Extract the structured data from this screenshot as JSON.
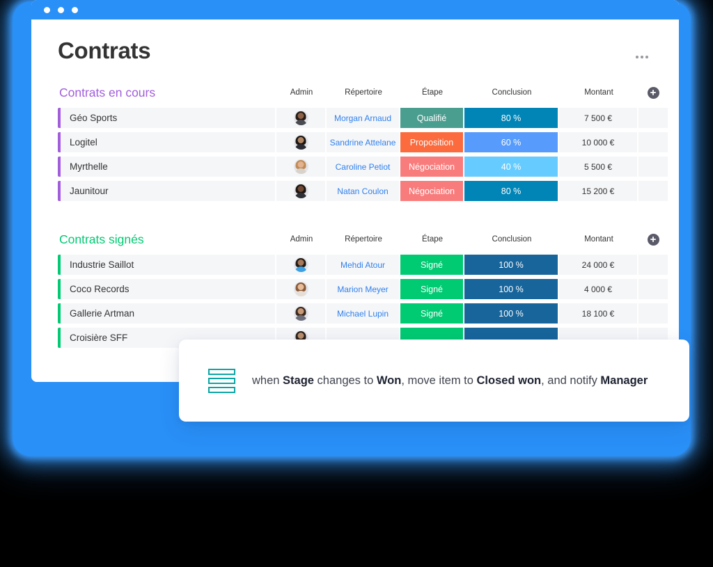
{
  "window": {
    "dots": [
      "dot-red",
      "dot-yellow",
      "dot-green"
    ],
    "brand_blue": "#2990f8"
  },
  "header": {
    "title": "Contrats",
    "menu_icon": "kebab-menu-icon"
  },
  "columns": {
    "admin": "Admin",
    "repertoire": "Répertoire",
    "etape": "Étape",
    "conclusion": "Conclusion",
    "montant": "Montant",
    "add": "+"
  },
  "boards": [
    {
      "title": "Contrats en cours",
      "accent": "#a25ddc",
      "rows": [
        {
          "name": "Géo Sports",
          "admin_avatar": "avatar-man-dark",
          "repertoire": "Morgan Arnaud",
          "etape": "Qualifié",
          "etape_color": "#4a9e8f",
          "conclusion": "80 %",
          "conclusion_color": "#0085b6",
          "montant": "7 500 €"
        },
        {
          "name": "Logitel",
          "admin_avatar": "avatar-woman-dark-hair",
          "repertoire": "Sandrine Attelane",
          "etape": "Proposition",
          "etape_color": "#fb6b3d",
          "conclusion": "60 %",
          "conclusion_color": "#579bfc",
          "montant": "10 000 €"
        },
        {
          "name": "Myrthelle",
          "admin_avatar": "avatar-woman-blonde",
          "repertoire": "Caroline Petiot",
          "etape": "Négociation",
          "etape_color": "#f97c7c",
          "conclusion": "40 %",
          "conclusion_color": "#66ccff",
          "montant": "5 500 €"
        },
        {
          "name": "Jaunitour",
          "admin_avatar": "avatar-man-beard",
          "repertoire": "Natan Coulon",
          "etape": "Négociation",
          "etape_color": "#f97c7c",
          "conclusion": "80 %",
          "conclusion_color": "#0085b6",
          "montant": "15 200 €"
        }
      ]
    },
    {
      "title": "Contrats signés",
      "accent": "#00ca72",
      "rows": [
        {
          "name": "Industrie Saillot",
          "admin_avatar": "avatar-man-blue-shirt",
          "repertoire": "Mehdi Atour",
          "etape": "Signé",
          "etape_color": "#00ca72",
          "conclusion": "100 %",
          "conclusion_color": "#17659b",
          "montant": "24 000 €"
        },
        {
          "name": "Coco Records",
          "admin_avatar": "avatar-woman-smiling",
          "repertoire": "Marion Meyer",
          "etape": "Signé",
          "etape_color": "#00ca72",
          "conclusion": "100 %",
          "conclusion_color": "#17659b",
          "montant": "4 000 €"
        },
        {
          "name": "Gallerie Artman",
          "admin_avatar": "avatar-man-short-hair",
          "repertoire": "Michael Lupin",
          "etape": "Signé",
          "etape_color": "#00ca72",
          "conclusion": "100 %",
          "conclusion_color": "#17659b",
          "montant": "18 100 €"
        },
        {
          "name": "Croisière SFF",
          "admin_avatar": "avatar-person",
          "repertoire": "",
          "etape": "",
          "etape_color": "#00ca72",
          "conclusion": "",
          "conclusion_color": "#17659b",
          "montant": ""
        }
      ]
    }
  ],
  "automation": {
    "icon": "stacked-bars-icon",
    "icon_color": "#0ba5a5",
    "parts": [
      {
        "text": "when ",
        "bold": false
      },
      {
        "text": "Stage",
        "bold": true
      },
      {
        "text": " changes to ",
        "bold": false
      },
      {
        "text": "Won",
        "bold": true
      },
      {
        "text": ", move item to ",
        "bold": false
      },
      {
        "text": "Closed won",
        "bold": true
      },
      {
        "text": ", and notify ",
        "bold": false
      },
      {
        "text": "Manager",
        "bold": true
      }
    ]
  }
}
